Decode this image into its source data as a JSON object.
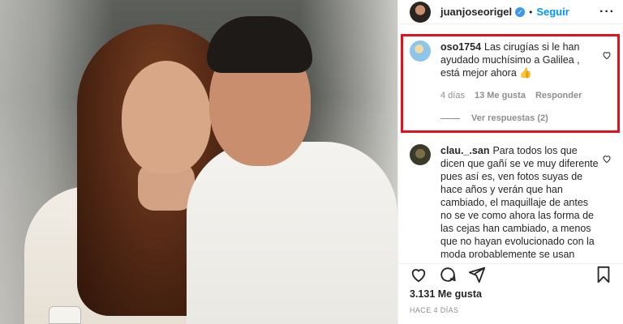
{
  "post": {
    "owner": "juanjoseorigel",
    "follow_label": "Seguir",
    "likes": "3.131 Me gusta",
    "date": "HACE 4 DÍAS"
  },
  "comments": [
    {
      "username": "oso1754",
      "text": "Las cirugías si le han ayudado muchísimo a Galilea , está mejor ahora 👍",
      "time": "4 días",
      "likes": "13 Me gusta",
      "reply_label": "Responder",
      "view_replies": "Ver respuestas (2)"
    },
    {
      "username": "clau._.san",
      "text": "Para todos los que dicen que gañí se ve muy diferente pues así es, ven fotos suyas de hace años y verán que han cambiado, el maquillaje de antes no se ve como ahora las forma de las cejas han cambiado, a menos que no hayan evolucionado con la moda probablemente se usan igual"
    }
  ],
  "icons": {
    "verified": "verified-badge-icon",
    "more": "more-options-icon",
    "like": "heart-icon",
    "comment": "comment-icon",
    "share": "share-icon",
    "save": "bookmark-icon"
  },
  "colors": {
    "accent": "#0095f6",
    "highlight": "#e3111b"
  }
}
